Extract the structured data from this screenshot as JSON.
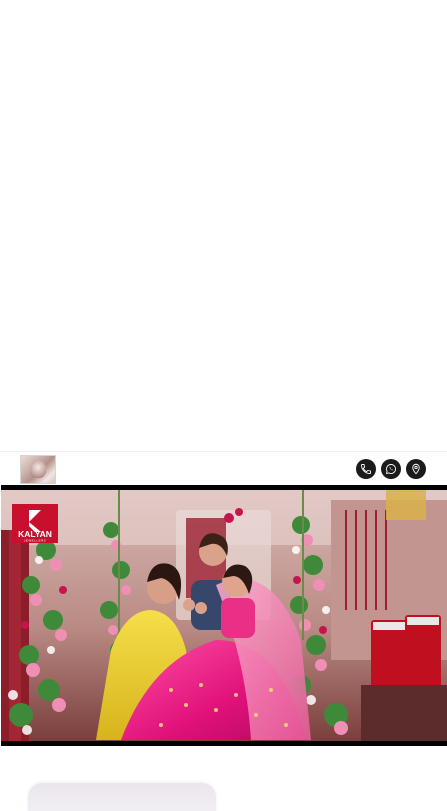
{
  "header": {
    "thumbnail_icon": "jewellery-thumbnail",
    "actions": [
      {
        "name": "call",
        "icon": "phone-icon"
      },
      {
        "name": "whatsapp",
        "icon": "whatsapp-icon"
      },
      {
        "name": "location",
        "icon": "location-pin-icon"
      }
    ],
    "button_color": "#1b1b1b"
  },
  "video": {
    "logo_text": "KALYAN",
    "logo_subtext": "JEWELLERS",
    "logo_color": "#c8102e"
  }
}
